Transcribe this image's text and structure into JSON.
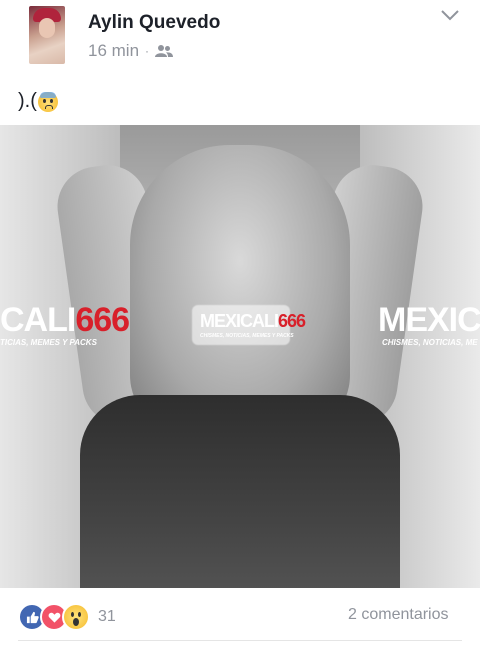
{
  "post": {
    "author_name": "Aylin Quevedo",
    "time_ago": "16 min",
    "separator": "·",
    "audience_icon": "friends-icon",
    "menu_icon": "chevron-down-icon",
    "text": ").(",
    "text_emoji": "anxious-face-emoji"
  },
  "photo": {
    "watermark_left_a": "CALI",
    "watermark_left_b": "666",
    "watermark_left_sub": "TICIAS, MEMES Y PACKS",
    "watermark_center_a": "MEXICALI",
    "watermark_center_b": "666",
    "watermark_center_sub": "CHISMES, NOTICIAS, MEMES Y PACKS",
    "watermark_right_a": "MEXICAL",
    "watermark_right_sub": "CHISMES, NOTICIAS, ME"
  },
  "footer": {
    "reaction_icons": [
      "like-icon",
      "love-icon",
      "wow-icon"
    ],
    "reaction_count": "31",
    "comments_label": "2 comentarios"
  },
  "colors": {
    "text_primary": "#1d2129",
    "text_secondary": "#90949c",
    "like_blue": "#4267b2",
    "love_red": "#f25268",
    "watermark_red": "#d8202a"
  }
}
